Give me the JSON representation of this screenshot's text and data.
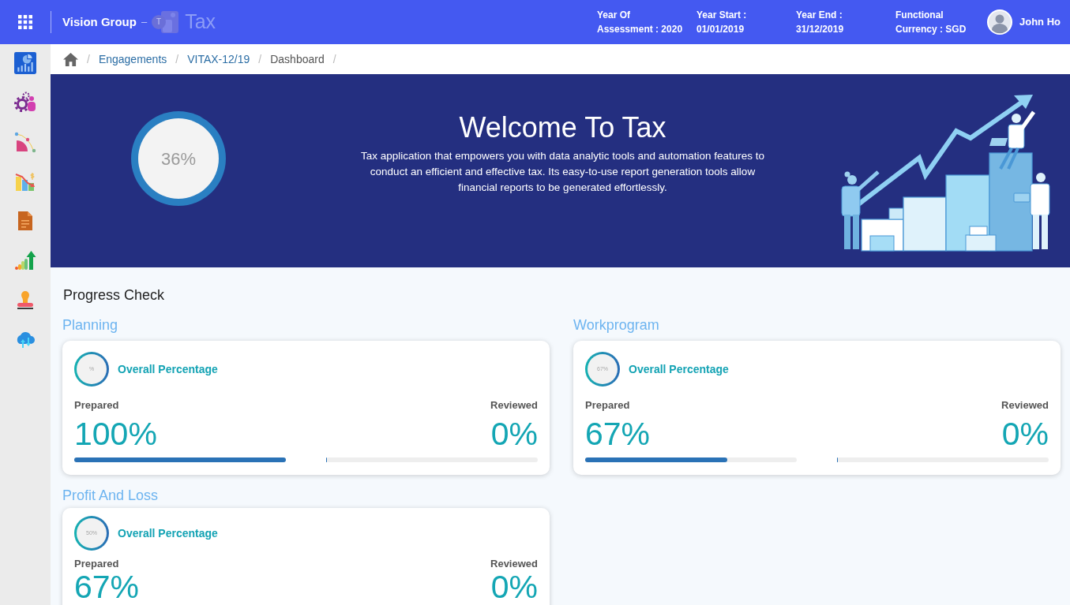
{
  "header": {
    "company": "Vision Group",
    "dash": "–",
    "logo_letter": "T",
    "app_name": "Tax",
    "info": [
      {
        "lines": [
          "Year Of",
          "Assessment : 2020"
        ]
      },
      {
        "lines": [
          "Year Start :",
          "01/01/2019"
        ]
      },
      {
        "lines": [
          "Year End :",
          "31/12/2019"
        ]
      },
      {
        "lines": [
          "Functional",
          "Currency : SGD"
        ]
      }
    ],
    "user": {
      "name": "John Ho"
    }
  },
  "sidebar": {
    "items": [
      {
        "kind": "dashboard"
      },
      {
        "kind": "settings"
      },
      {
        "kind": "curve"
      },
      {
        "kind": "finance"
      },
      {
        "kind": "document"
      },
      {
        "kind": "growth"
      },
      {
        "kind": "stamp"
      },
      {
        "kind": "cloud"
      }
    ]
  },
  "breadcrumb": {
    "separator": "/",
    "items": [
      {
        "label": "Engagements",
        "kind": "link"
      },
      {
        "label": "VITAX-12/19",
        "kind": "link"
      },
      {
        "label": "Dashboard",
        "kind": "current"
      }
    ]
  },
  "hero": {
    "ring_text": "36%",
    "title": "Welcome To Tax",
    "description": "Tax application that empowers you with data analytic tools and automation features to conduct an efficient and effective tax. Its easy-to-use report generation tools allow financial reports to be generated effortlessly."
  },
  "progress": {
    "title": "Progress Check",
    "sections": [
      {
        "title": "Planning",
        "card": {
          "ring_text": "%",
          "heading": "Overall Percentage",
          "prepared": {
            "label": "Prepared",
            "value": "100%",
            "level": 1
          },
          "reviewed": {
            "label": "Reviewed",
            "value": "0%",
            "level": 0
          }
        }
      },
      {
        "title": "Workprogram",
        "card": {
          "ring_text": "67%",
          "heading": "Overall Percentage",
          "prepared": {
            "label": "Prepared",
            "value": "67%",
            "level": 0.67
          },
          "reviewed": {
            "label": "Reviewed",
            "value": "0%",
            "level": 0
          }
        }
      },
      {
        "title": "Profit And Loss",
        "card": {
          "ring_text": "50%",
          "heading": "Overall Percentage",
          "prepared": {
            "label": "Prepared",
            "value": "67%"
          },
          "reviewed": {
            "label": "Reviewed",
            "value": "0%"
          }
        }
      }
    ]
  }
}
